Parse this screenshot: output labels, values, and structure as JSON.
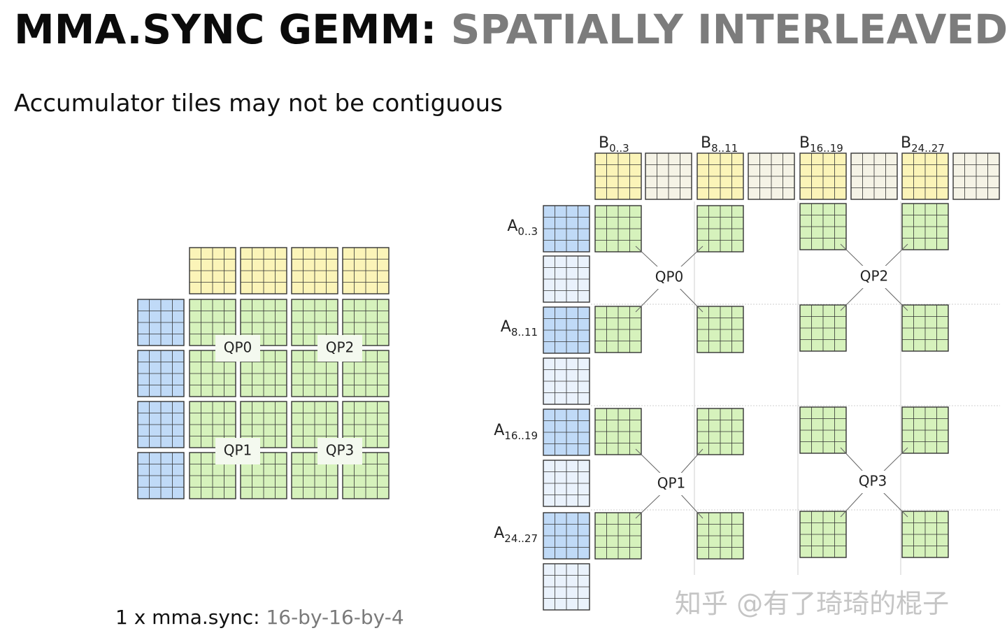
{
  "title": {
    "part1": "MMA.SYNC GEMM:",
    "part2": "SPATIALLY INTERLEAVED"
  },
  "subtitle": "Accumulator tiles may not be contiguous",
  "left_diagram": {
    "quad_labels": [
      "QP0",
      "QP2",
      "QP1",
      "QP3"
    ]
  },
  "right_diagram": {
    "b_labels": [
      {
        "base": "B",
        "sub": "0..3"
      },
      {
        "base": "B",
        "sub": "8..11"
      },
      {
        "base": "B",
        "sub": "16..19"
      },
      {
        "base": "B",
        "sub": "24..27"
      }
    ],
    "a_labels": [
      {
        "base": "A",
        "sub": "0..3"
      },
      {
        "base": "A",
        "sub": "8..11"
      },
      {
        "base": "A",
        "sub": "16..19"
      },
      {
        "base": "A",
        "sub": "24..27"
      }
    ],
    "qp_labels": [
      "QP0",
      "QP2",
      "QP1",
      "QP3"
    ]
  },
  "footer": {
    "part1": "1 x mma.sync:",
    "part2": "16-by-16-by-4"
  },
  "watermark": "知乎 @有了琦琦的棍子",
  "colors": {
    "yellow": "#fbf4b8",
    "blue": "#c0daf7",
    "light_blue": "#eaf2fc",
    "green": "#d6f2bc",
    "light_tan": "#f5f3e6",
    "grid_line": "#333333",
    "connector": "#666666",
    "guide": "#cfcfcf"
  }
}
